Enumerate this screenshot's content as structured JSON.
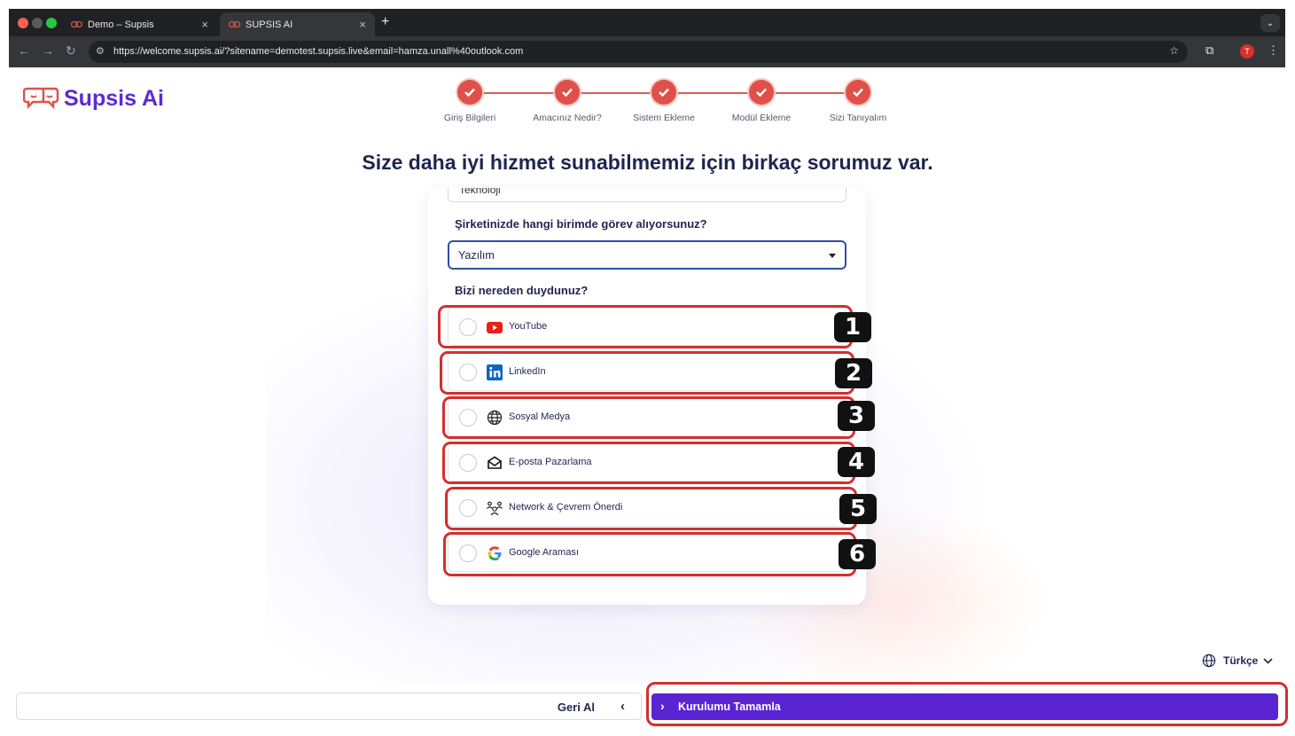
{
  "browser": {
    "tabs": [
      {
        "title": "Demo – Supsis",
        "active": false
      },
      {
        "title": "SUPSIS AI",
        "active": true
      }
    ],
    "url": "https://welcome.supsis.ai/?sitename=demotest.supsis.live&email=hamza.unall%40outlook.com",
    "profile_initial": "T"
  },
  "brand": {
    "name": "Supsis Ai",
    "color": "#5b2bd3"
  },
  "stepper": {
    "steps": [
      "Giriş Bilgileri",
      "Amacınız Nedir?",
      "Sistem Ekleme",
      "Modül Ekleme",
      "Sizi Tanıyalım"
    ],
    "accent": "#e0504a"
  },
  "heading": "Size daha iyi hizmet sunabilmemiz için birkaç sorumuz var.",
  "form": {
    "previous_select_value": "Teknoloji",
    "department_question": "Şirketinizde hangi birimde görev alıyorsunuz?",
    "department_value": "Yazılım",
    "source_question": "Bizi nereden duydunuz?",
    "options": [
      {
        "label": "YouTube",
        "icon": "youtube-icon"
      },
      {
        "label": "LinkedIn",
        "icon": "linkedin-icon"
      },
      {
        "label": "Sosyal Medya",
        "icon": "globe-icon"
      },
      {
        "label": "E-posta Pazarlama",
        "icon": "envelope-icon"
      },
      {
        "label": "Network & Çevrem Önerdi",
        "icon": "people-icon"
      },
      {
        "label": "Google Araması",
        "icon": "google-icon"
      }
    ]
  },
  "annotations": [
    "1",
    "2",
    "3",
    "4",
    "5",
    "6"
  ],
  "language": {
    "label": "Türkçe"
  },
  "footer": {
    "back_label": "Geri Al",
    "finish_label": "Kurulumu Tamamla",
    "finish_color": "#5a24d3"
  }
}
